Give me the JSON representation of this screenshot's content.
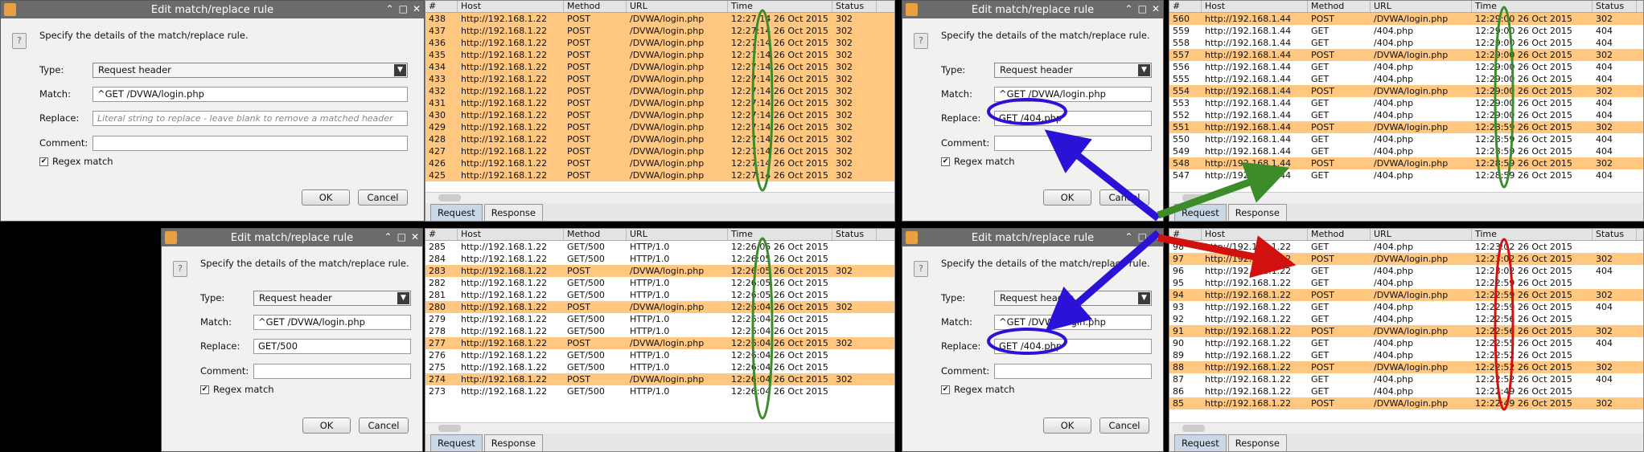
{
  "dialogs": [
    {
      "title": "Edit match/replace rule",
      "prompt": "Specify the details of the match/replace rule.",
      "type_label": "Type:",
      "type_value": "Request header",
      "match_label": "Match:",
      "match_value": "^GET /DVWA/login.php",
      "replace_label": "Replace:",
      "replace_value": "",
      "replace_placeholder": "Literal string to replace - leave blank to remove a matched header",
      "comment_label": "Comment:",
      "comment_value": "",
      "regex_label": "Regex match",
      "ok": "OK",
      "cancel": "Cancel"
    },
    {
      "title": "Edit match/replace rule",
      "prompt": "Specify the details of the match/replace rule.",
      "type_label": "Type:",
      "type_value": "Request header",
      "match_label": "Match:",
      "match_value": "^GET /DVWA/login.php",
      "replace_label": "Replace:",
      "replace_value": "GET/500",
      "replace_placeholder": "",
      "comment_label": "Comment:",
      "comment_value": "",
      "regex_label": "Regex match",
      "ok": "OK",
      "cancel": "Cancel"
    },
    {
      "title": "Edit match/replace rule",
      "prompt": "Specify the details of the match/replace rule.",
      "type_label": "Type:",
      "type_value": "Request header",
      "match_label": "Match:",
      "match_value": "^GET /DVWA/login.php",
      "replace_label": "Replace:",
      "replace_value": "GET /404.php",
      "replace_placeholder": "",
      "comment_label": "Comment:",
      "comment_value": "",
      "regex_label": "Regex match",
      "ok": "OK",
      "cancel": "Cancel"
    },
    {
      "title": "Edit match/replace rule",
      "prompt": "Specify the details of the match/replace rule.",
      "type_label": "Type:",
      "type_value": "Request header",
      "match_label": "Match:",
      "match_value": "^GET /DVWA/login.php",
      "replace_label": "Replace:",
      "replace_value": "GET /404.php",
      "replace_placeholder": "",
      "comment_label": "Comment:",
      "comment_value": "",
      "regex_label": "Regex match",
      "ok": "OK",
      "cancel": "Cancel"
    }
  ],
  "tables": [
    {
      "headers": [
        "#",
        "Host",
        "Method",
        "URL",
        "Time",
        "Status"
      ],
      "rows": [
        {
          "n": "438",
          "host": "http://192.168.1.22",
          "method": "POST",
          "url": "/DVWA/login.php",
          "time": "12:27:14 26 Oct 2015",
          "status": "302",
          "hl": true
        },
        {
          "n": "437",
          "host": "http://192.168.1.22",
          "method": "POST",
          "url": "/DVWA/login.php",
          "time": "12:27:14 26 Oct 2015",
          "status": "302",
          "hl": true
        },
        {
          "n": "436",
          "host": "http://192.168.1.22",
          "method": "POST",
          "url": "/DVWA/login.php",
          "time": "12:27:14 26 Oct 2015",
          "status": "302",
          "hl": true
        },
        {
          "n": "435",
          "host": "http://192.168.1.22",
          "method": "POST",
          "url": "/DVWA/login.php",
          "time": "12:27:14 26 Oct 2015",
          "status": "302",
          "hl": true
        },
        {
          "n": "434",
          "host": "http://192.168.1.22",
          "method": "POST",
          "url": "/DVWA/login.php",
          "time": "12:27:14 26 Oct 2015",
          "status": "302",
          "hl": true
        },
        {
          "n": "433",
          "host": "http://192.168.1.22",
          "method": "POST",
          "url": "/DVWA/login.php",
          "time": "12:27:14 26 Oct 2015",
          "status": "302",
          "hl": true
        },
        {
          "n": "432",
          "host": "http://192.168.1.22",
          "method": "POST",
          "url": "/DVWA/login.php",
          "time": "12:27:14 26 Oct 2015",
          "status": "302",
          "hl": true
        },
        {
          "n": "431",
          "host": "http://192.168.1.22",
          "method": "POST",
          "url": "/DVWA/login.php",
          "time": "12:27:14 26 Oct 2015",
          "status": "302",
          "hl": true
        },
        {
          "n": "430",
          "host": "http://192.168.1.22",
          "method": "POST",
          "url": "/DVWA/login.php",
          "time": "12:27:14 26 Oct 2015",
          "status": "302",
          "hl": true
        },
        {
          "n": "429",
          "host": "http://192.168.1.22",
          "method": "POST",
          "url": "/DVWA/login.php",
          "time": "12:27:14 26 Oct 2015",
          "status": "302",
          "hl": true
        },
        {
          "n": "428",
          "host": "http://192.168.1.22",
          "method": "POST",
          "url": "/DVWA/login.php",
          "time": "12:27:14 26 Oct 2015",
          "status": "302",
          "hl": true
        },
        {
          "n": "427",
          "host": "http://192.168.1.22",
          "method": "POST",
          "url": "/DVWA/login.php",
          "time": "12:27:14 26 Oct 2015",
          "status": "302",
          "hl": true
        },
        {
          "n": "426",
          "host": "http://192.168.1.22",
          "method": "POST",
          "url": "/DVWA/login.php",
          "time": "12:27:14 26 Oct 2015",
          "status": "302",
          "hl": true
        },
        {
          "n": "425",
          "host": "http://192.168.1.22",
          "method": "POST",
          "url": "/DVWA/login.php",
          "time": "12:27:14 26 Oct 2015",
          "status": "302",
          "hl": true
        }
      ]
    },
    {
      "headers": [
        "#",
        "Host",
        "Method",
        "URL",
        "Time",
        "Status"
      ],
      "rows": [
        {
          "n": "560",
          "host": "http://192.168.1.44",
          "method": "POST",
          "url": "/DVWA/login.php",
          "time": "12:29:00 26 Oct 2015",
          "status": "302",
          "hl": true
        },
        {
          "n": "559",
          "host": "http://192.168.1.44",
          "method": "GET",
          "url": "/404.php",
          "time": "12:29:00 26 Oct 2015",
          "status": "404",
          "hl": false
        },
        {
          "n": "558",
          "host": "http://192.168.1.44",
          "method": "GET",
          "url": "/404.php",
          "time": "12:29:00 26 Oct 2015",
          "status": "404",
          "hl": false
        },
        {
          "n": "557",
          "host": "http://192.168.1.44",
          "method": "POST",
          "url": "/DVWA/login.php",
          "time": "12:29:00 26 Oct 2015",
          "status": "302",
          "hl": true
        },
        {
          "n": "556",
          "host": "http://192.168.1.44",
          "method": "GET",
          "url": "/404.php",
          "time": "12:29:00 26 Oct 2015",
          "status": "404",
          "hl": false
        },
        {
          "n": "555",
          "host": "http://192.168.1.44",
          "method": "GET",
          "url": "/404.php",
          "time": "12:29:00 26 Oct 2015",
          "status": "404",
          "hl": false
        },
        {
          "n": "554",
          "host": "http://192.168.1.44",
          "method": "POST",
          "url": "/DVWA/login.php",
          "time": "12:29:00 26 Oct 2015",
          "status": "302",
          "hl": true
        },
        {
          "n": "553",
          "host": "http://192.168.1.44",
          "method": "GET",
          "url": "/404.php",
          "time": "12:29:00 26 Oct 2015",
          "status": "404",
          "hl": false
        },
        {
          "n": "552",
          "host": "http://192.168.1.44",
          "method": "GET",
          "url": "/404.php",
          "time": "12:29:00 26 Oct 2015",
          "status": "404",
          "hl": false
        },
        {
          "n": "551",
          "host": "http://192.168.1.44",
          "method": "POST",
          "url": "/DVWA/login.php",
          "time": "12:28:59 26 Oct 2015",
          "status": "302",
          "hl": true
        },
        {
          "n": "550",
          "host": "http://192.168.1.44",
          "method": "GET",
          "url": "/404.php",
          "time": "12:28:59 26 Oct 2015",
          "status": "404",
          "hl": false
        },
        {
          "n": "549",
          "host": "http://192.168.1.44",
          "method": "GET",
          "url": "/404.php",
          "time": "12:28:59 26 Oct 2015",
          "status": "404",
          "hl": false
        },
        {
          "n": "548",
          "host": "http://192.168.1.44",
          "method": "POST",
          "url": "/DVWA/login.php",
          "time": "12:28:59 26 Oct 2015",
          "status": "302",
          "hl": true
        },
        {
          "n": "547",
          "host": "http://192.168.1.44",
          "method": "GET",
          "url": "/404.php",
          "time": "12:28:59 26 Oct 2015",
          "status": "404",
          "hl": false
        }
      ]
    },
    {
      "headers": [
        "#",
        "Host",
        "Method",
        "URL",
        "Time",
        "Status"
      ],
      "rows": [
        {
          "n": "285",
          "host": "http://192.168.1.22",
          "method": "GET/500",
          "url": "HTTP/1.0",
          "time": "12:26:05 26 Oct 2015",
          "status": "",
          "hl": false
        },
        {
          "n": "284",
          "host": "http://192.168.1.22",
          "method": "GET/500",
          "url": "HTTP/1.0",
          "time": "12:26:05 26 Oct 2015",
          "status": "",
          "hl": false
        },
        {
          "n": "283",
          "host": "http://192.168.1.22",
          "method": "POST",
          "url": "/DVWA/login.php",
          "time": "12:26:05 26 Oct 2015",
          "status": "302",
          "hl": true
        },
        {
          "n": "282",
          "host": "http://192.168.1.22",
          "method": "GET/500",
          "url": "HTTP/1.0",
          "time": "12:26:05 26 Oct 2015",
          "status": "",
          "hl": false
        },
        {
          "n": "281",
          "host": "http://192.168.1.22",
          "method": "GET/500",
          "url": "HTTP/1.0",
          "time": "12:26:05 26 Oct 2015",
          "status": "",
          "hl": false
        },
        {
          "n": "280",
          "host": "http://192.168.1.22",
          "method": "POST",
          "url": "/DVWA/login.php",
          "time": "12:26:04 26 Oct 2015",
          "status": "302",
          "hl": true
        },
        {
          "n": "279",
          "host": "http://192.168.1.22",
          "method": "GET/500",
          "url": "HTTP/1.0",
          "time": "12:26:04 26 Oct 2015",
          "status": "",
          "hl": false
        },
        {
          "n": "278",
          "host": "http://192.168.1.22",
          "method": "GET/500",
          "url": "HTTP/1.0",
          "time": "12:26:04 26 Oct 2015",
          "status": "",
          "hl": false
        },
        {
          "n": "277",
          "host": "http://192.168.1.22",
          "method": "POST",
          "url": "/DVWA/login.php",
          "time": "12:26:04 26 Oct 2015",
          "status": "302",
          "hl": true
        },
        {
          "n": "276",
          "host": "http://192.168.1.22",
          "method": "GET/500",
          "url": "HTTP/1.0",
          "time": "12:26:04 26 Oct 2015",
          "status": "",
          "hl": false
        },
        {
          "n": "275",
          "host": "http://192.168.1.22",
          "method": "GET/500",
          "url": "HTTP/1.0",
          "time": "12:26:04 26 Oct 2015",
          "status": "",
          "hl": false
        },
        {
          "n": "274",
          "host": "http://192.168.1.22",
          "method": "POST",
          "url": "/DVWA/login.php",
          "time": "12:26:04 26 Oct 2015",
          "status": "302",
          "hl": true
        },
        {
          "n": "273",
          "host": "http://192.168.1.22",
          "method": "GET/500",
          "url": "HTTP/1.0",
          "time": "12:26:04 26 Oct 2015",
          "status": "",
          "hl": false
        }
      ]
    },
    {
      "headers": [
        "#",
        "Host",
        "Method",
        "URL",
        "Time",
        "Status"
      ],
      "rows": [
        {
          "n": "98",
          "host": "http://192.168.1.22",
          "method": "GET",
          "url": "/404.php",
          "time": "12:23:02 26 Oct 2015",
          "status": "",
          "hl": false
        },
        {
          "n": "97",
          "host": "http://192.168.1.22",
          "method": "POST",
          "url": "/DVWA/login.php",
          "time": "12:23:02 26 Oct 2015",
          "status": "302",
          "hl": true
        },
        {
          "n": "96",
          "host": "http://192.168.1.22",
          "method": "GET",
          "url": "/404.php",
          "time": "12:23:02 26 Oct 2015",
          "status": "404",
          "hl": false
        },
        {
          "n": "95",
          "host": "http://192.168.1.22",
          "method": "GET",
          "url": "/404.php",
          "time": "12:22:59 26 Oct 2015",
          "status": "",
          "hl": false
        },
        {
          "n": "94",
          "host": "http://192.168.1.22",
          "method": "POST",
          "url": "/DVWA/login.php",
          "time": "12:22:59 26 Oct 2015",
          "status": "302",
          "hl": true
        },
        {
          "n": "93",
          "host": "http://192.168.1.22",
          "method": "GET",
          "url": "/404.php",
          "time": "12:22:59 26 Oct 2015",
          "status": "404",
          "hl": false
        },
        {
          "n": "92",
          "host": "http://192.168.1.22",
          "method": "GET",
          "url": "/404.php",
          "time": "12:22:56 26 Oct 2015",
          "status": "",
          "hl": false
        },
        {
          "n": "91",
          "host": "http://192.168.1.22",
          "method": "POST",
          "url": "/DVWA/login.php",
          "time": "12:22:56 26 Oct 2015",
          "status": "302",
          "hl": true
        },
        {
          "n": "90",
          "host": "http://192.168.1.22",
          "method": "GET",
          "url": "/404.php",
          "time": "12:22:55 26 Oct 2015",
          "status": "404",
          "hl": false
        },
        {
          "n": "89",
          "host": "http://192.168.1.22",
          "method": "GET",
          "url": "/404.php",
          "time": "12:22:52 26 Oct 2015",
          "status": "",
          "hl": false
        },
        {
          "n": "88",
          "host": "http://192.168.1.22",
          "method": "POST",
          "url": "/DVWA/login.php",
          "time": "12:22:52 26 Oct 2015",
          "status": "302",
          "hl": true
        },
        {
          "n": "87",
          "host": "http://192.168.1.22",
          "method": "GET",
          "url": "/404.php",
          "time": "12:22:52 26 Oct 2015",
          "status": "404",
          "hl": false
        },
        {
          "n": "86",
          "host": "http://192.168.1.22",
          "method": "GET",
          "url": "/404.php",
          "time": "12:22:49 26 Oct 2015",
          "status": "",
          "hl": false
        },
        {
          "n": "85",
          "host": "http://192.168.1.22",
          "method": "POST",
          "url": "/DVWA/login.php",
          "time": "12:22:49 26 Oct 2015",
          "status": "302",
          "hl": true
        }
      ]
    }
  ],
  "tabs": {
    "request": "Request",
    "response": "Response"
  },
  "colors": {
    "highlight_row": "#ffc77f",
    "annotation_blue": "#2a12d6",
    "annotation_green": "#3c8d2a",
    "annotation_red": "#d11010"
  }
}
